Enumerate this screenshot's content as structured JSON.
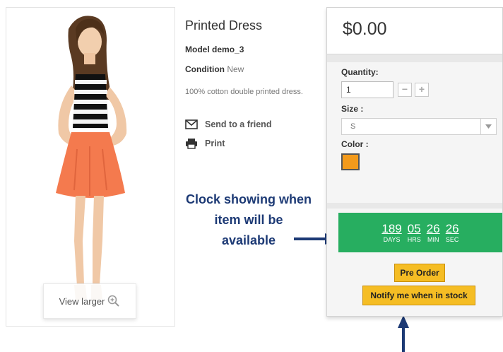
{
  "product": {
    "title": "Printed Dress",
    "model_label": "Model",
    "model_value": "demo_3",
    "condition_label": "Condition",
    "condition_value": "New",
    "description": "100% cotton double printed dress."
  },
  "image": {
    "view_larger_label": "View larger",
    "zoom_icon": "zoom-in-icon"
  },
  "actions": {
    "send_to_friend": "Send to a friend",
    "print": "Print",
    "icons": [
      "envelope-icon",
      "printer-icon"
    ]
  },
  "buybox": {
    "price": "$0.00",
    "quantity_label": "Quantity:",
    "quantity_value": "1",
    "minus": "−",
    "plus": "+",
    "size_label": "Size :",
    "size_selected": "S",
    "color_label": "Color :",
    "color_swatch": "#f39a1b"
  },
  "countdown": {
    "days": "189",
    "days_label": "DAYS",
    "hours": "05",
    "hours_label": "HRS",
    "minutes": "26",
    "minutes_label": "MIN",
    "seconds": "26",
    "seconds_label": "SEC",
    "background": "#27ae60"
  },
  "buttons": {
    "pre_order": "Pre Order",
    "notify": "Notify me when in stock",
    "color": "#f5bd24"
  },
  "annotation": {
    "line1": "Clock showing when",
    "line2": "item will be",
    "line3": "available",
    "color": "#1d3a75"
  }
}
